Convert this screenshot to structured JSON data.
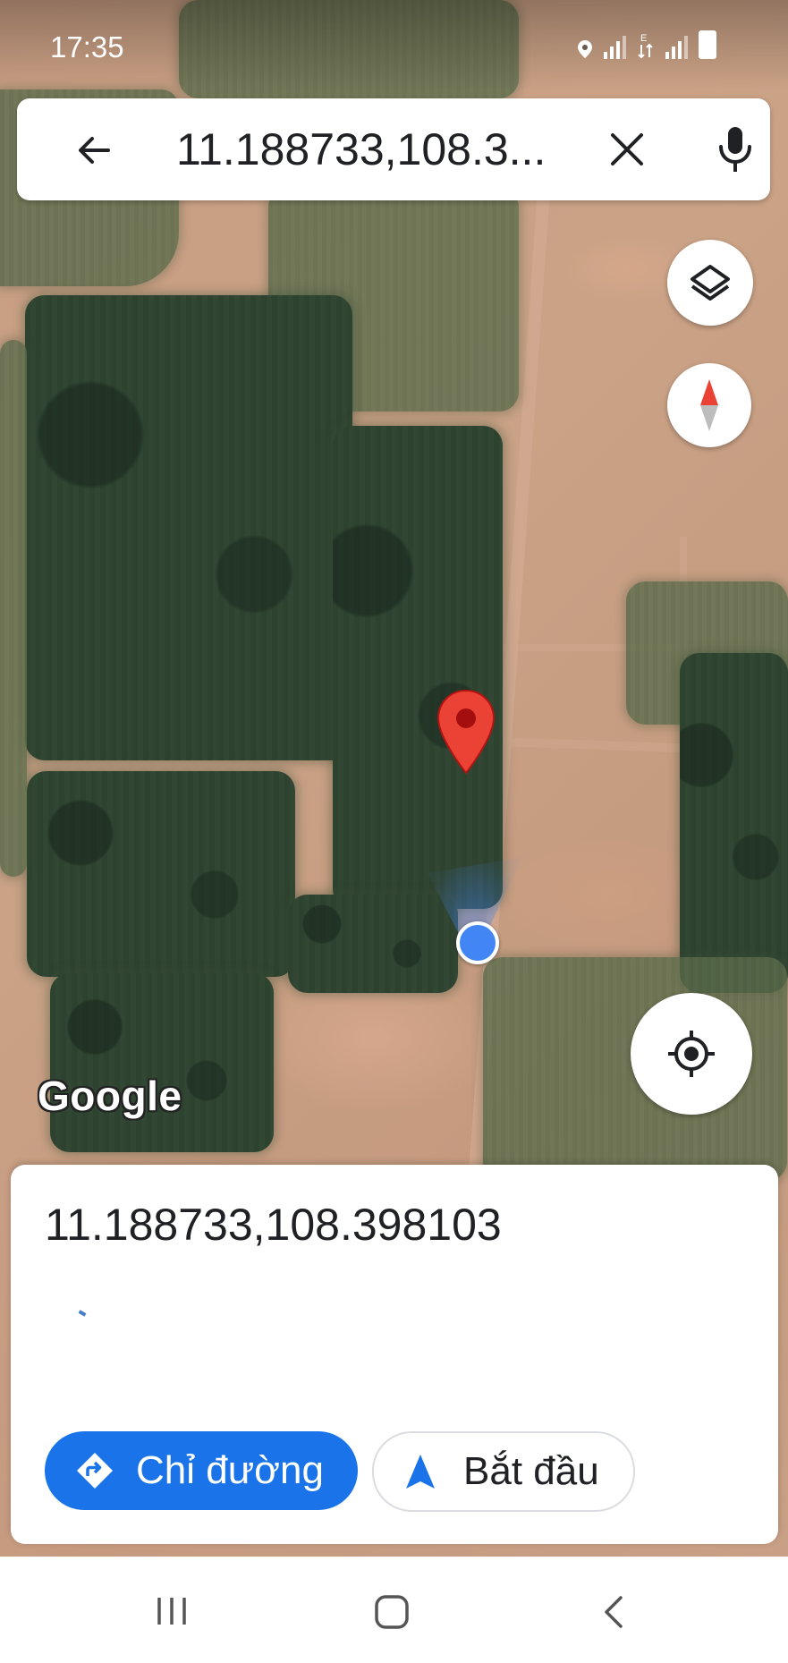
{
  "status_bar": {
    "time": "17:35",
    "icons": [
      "location-icon",
      "signal-icon",
      "data-transfer-icon",
      "signal-icon",
      "battery-icon"
    ]
  },
  "search": {
    "value": "11.188733,108.3...",
    "back_icon": "back-arrow-icon",
    "clear_icon": "close-icon",
    "mic_icon": "microphone-icon"
  },
  "map": {
    "logo": "Google",
    "controls": [
      "layers-icon",
      "compass-icon",
      "my-location-icon"
    ]
  },
  "place_sheet": {
    "title": "11.188733,108.398103",
    "directions_label": "Chỉ đường",
    "start_label": "Bắt đầu"
  },
  "nav_bar": {
    "icons": [
      "recents-icon",
      "home-icon",
      "back-icon"
    ]
  },
  "colors": {
    "primary_blue": "#1a73e8",
    "pin_red": "#ea4335",
    "location_blue": "#4285f4"
  }
}
